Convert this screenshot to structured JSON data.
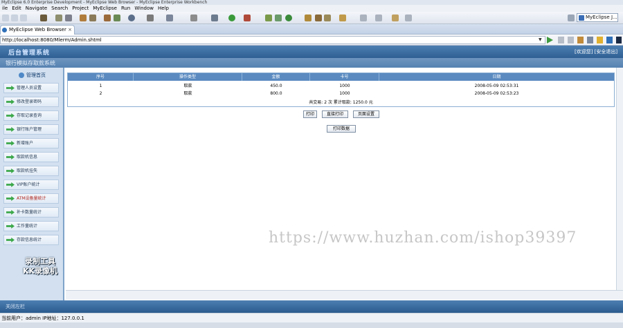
{
  "window": {
    "title": "MyEclipse 6.0 Enterprise Development - MyEclipse Web Browser - MyEclipse Enterprise Workbench"
  },
  "menu": [
    "ile",
    "Edit",
    "Navigate",
    "Search",
    "Project",
    "MyEclipse",
    "Run",
    "Window",
    "Help"
  ],
  "perspective": {
    "label": "MyEclipse J..."
  },
  "browser_tab": {
    "label": "MyEclipse Web Browser",
    "close": "×"
  },
  "url": {
    "value": "http://localhost:8080/Mlerm/Admin.shtml",
    "dropdown": "▼"
  },
  "app": {
    "title": "后台管理系统",
    "user_info": "[欢迎您] [安全退出]",
    "subtitle": "银行模拟存取款系统"
  },
  "sidebar": {
    "heading": "管理首页",
    "items": [
      {
        "label": "管理人员设置"
      },
      {
        "label": "修改登录密码"
      },
      {
        "label": "存取记录查询"
      },
      {
        "label": "银行账户管理"
      },
      {
        "label": "新增账户"
      },
      {
        "label": "取款机信息"
      },
      {
        "label": "取款机挂失"
      },
      {
        "label": "VIP账户统计"
      },
      {
        "label": "ATM设备量统计"
      },
      {
        "label": "补卡数量统计"
      },
      {
        "label": "工作量统计"
      },
      {
        "label": "存款信息统计"
      }
    ],
    "overlay_text": [
      "录制工具",
      "KK录像机"
    ]
  },
  "table": {
    "headers": [
      "序号",
      "操作类型",
      "金额",
      "卡号",
      "日期"
    ],
    "rows": [
      [
        "1",
        "取款",
        "450.0",
        "1000",
        "2008-05-09 02:53:31"
      ],
      [
        "2",
        "取款",
        "800.0",
        "1000",
        "2008-05-09 02:53:23"
      ]
    ],
    "summary": "共交易: 2 次 累计取款: 1250.0 元"
  },
  "buttons": {
    "print": "打印",
    "direct_print": "直接打印",
    "page_setup": "页面设置",
    "print_data": "打印数据"
  },
  "watermark": "https://www.huzhan.com/ishop39397",
  "footer": {
    "label": "关闭左栏"
  },
  "status": {
    "text": "当前用户：admin  IP地址：127.0.0.1"
  },
  "colors": {
    "header_blue": "#2f5f93",
    "sidebar_bg": "#d2e0f0",
    "table_header": "#5a8ac0",
    "menu_arrow": "#3ca84a"
  }
}
